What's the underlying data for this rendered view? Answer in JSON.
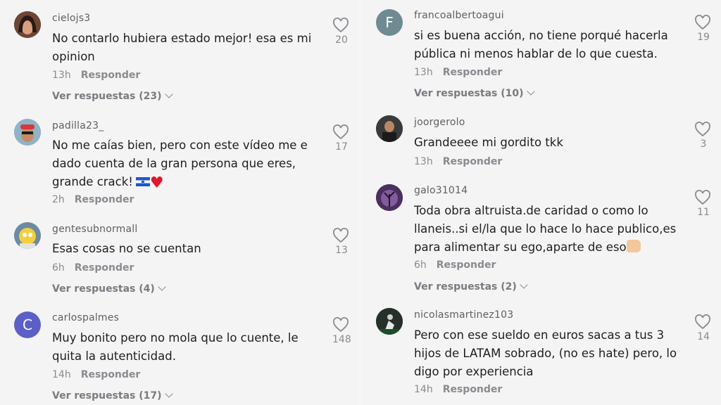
{
  "left": [
    {
      "username": "cielojs3",
      "text": "No contarlo hubiera estado mejor! esa es mi opinion",
      "time": "13h",
      "reply": "Responder",
      "replies": "Ver respuestas (23)",
      "likes": "20",
      "avatar_letter": "",
      "avatar_color": "#5a3a2e"
    },
    {
      "username": "padilla23_",
      "text": "No me caías bien, pero con este vídeo me e dado cuenta de la gran persona que eres, grande crack!",
      "time": "2h",
      "reply": "Responder",
      "replies": "",
      "likes": "17",
      "avatar_letter": "",
      "avatar_color": "#7fa3b8"
    },
    {
      "username": "gentesubnormall",
      "text": "Esas cosas no se cuentan",
      "time": "6h",
      "reply": "Responder",
      "replies": "Ver respuestas (4)",
      "likes": "13",
      "avatar_letter": "",
      "avatar_color": "#d8b23c"
    },
    {
      "username": "carlospalmes",
      "text": "Muy bonito pero no mola que lo cuente, le quita la autenticidad.",
      "time": "14h",
      "reply": "Responder",
      "replies": "Ver respuestas (17)",
      "likes": "148",
      "avatar_letter": "C",
      "avatar_color": "#5b5fc7"
    }
  ],
  "right": [
    {
      "username": "francoalbertoagui",
      "text": "si es buena acción, no tiene porqué hacerla pública ni menos hablar de lo que cuesta.",
      "time": "13h",
      "reply": "Responder",
      "replies": "Ver respuestas (10)",
      "likes": "19",
      "avatar_letter": "F",
      "avatar_color": "#6f8a93"
    },
    {
      "username": "joorgerolo",
      "text": "Grandeeee mi gordito tkk",
      "time": "13h",
      "reply": "Responder",
      "replies": "",
      "likes": "3",
      "avatar_letter": "",
      "avatar_color": "#4a4a4a"
    },
    {
      "username": "galo31014",
      "text": "Toda obra altruista.de caridad o como lo llaneis..si el/la que lo hace lo hace publico,es para alimentar su ego,aparte de eso",
      "time": "6h",
      "reply": "Responder",
      "replies": "Ver respuestas (2)",
      "likes": "11",
      "avatar_letter": "",
      "avatar_color": "#5b3f6e"
    },
    {
      "username": "nicolasmartinez103",
      "text": "Pero con ese sueldo en euros sacas a tus 3 hijos de LATAM sobrado, (no es hate) pero, lo digo por experiencia",
      "time": "14h",
      "reply": "Responder",
      "replies": "",
      "likes": "14",
      "avatar_letter": "",
      "avatar_color": "#2f3a36"
    }
  ],
  "icons": {
    "like": "heart-outline-icon",
    "expand": "chevron-down-icon"
  }
}
